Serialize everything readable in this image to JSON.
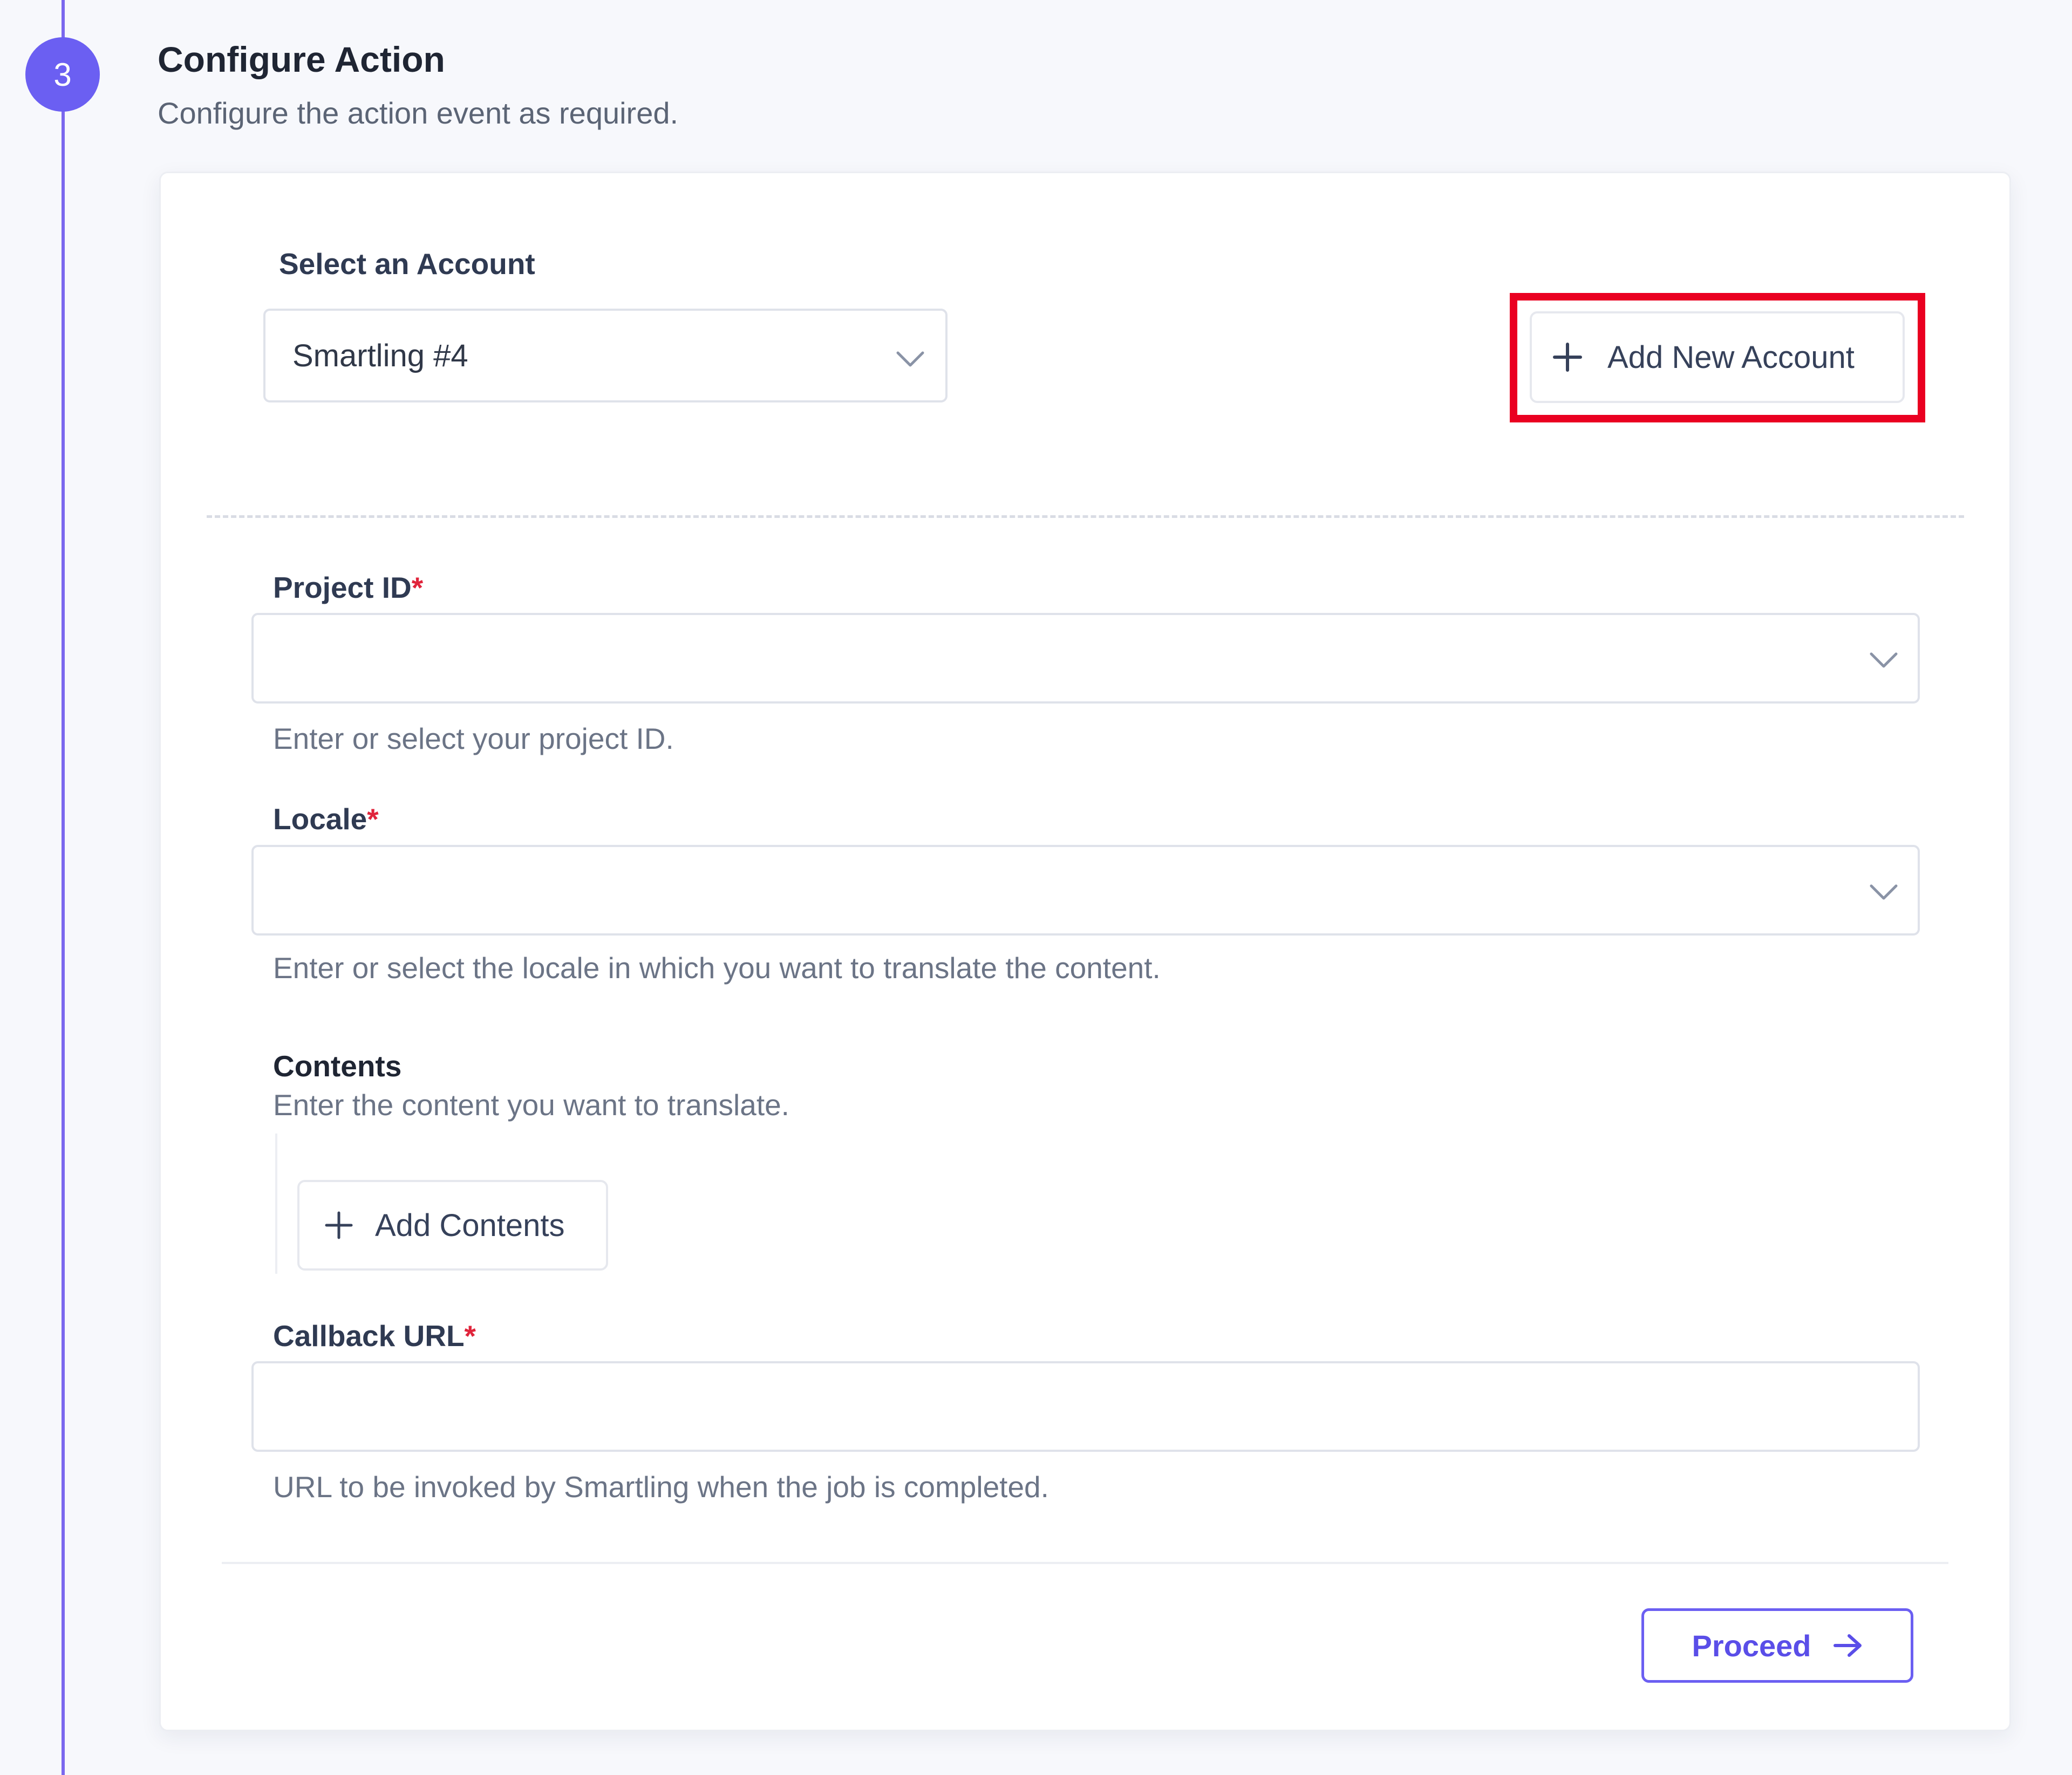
{
  "step": {
    "number": "3",
    "title": "Configure Action",
    "subtitle": "Configure the action event as required.",
    "accent_color": "#6b5ff2"
  },
  "account": {
    "label": "Select an Account",
    "selected": "Smartling #4",
    "icon": "chevron-down-icon",
    "add_button_label": "Add New Account",
    "add_button_icon": "plus-icon",
    "highlight_color": "#ea0021"
  },
  "fields": {
    "project_id": {
      "label": "Project ID",
      "required_mark": "*",
      "value": "",
      "help": "Enter or select your project ID."
    },
    "locale": {
      "label": "Locale",
      "required_mark": "*",
      "value": "",
      "help": "Enter or select the locale in which you want to translate the content."
    },
    "contents": {
      "label": "Contents",
      "help": "Enter the content you want to translate.",
      "add_button_label": "Add Contents",
      "add_button_icon": "plus-icon"
    },
    "callback_url": {
      "label": "Callback URL",
      "required_mark": "*",
      "value": "",
      "help": "URL to be invoked by Smartling when the job is completed."
    }
  },
  "footer": {
    "proceed_label": "Proceed",
    "proceed_icon": "arrow-right-icon"
  }
}
